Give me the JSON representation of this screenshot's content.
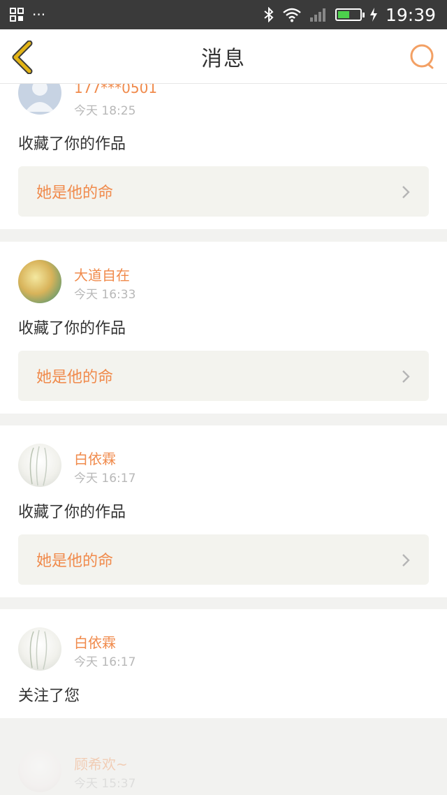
{
  "status_bar": {
    "left_dots": "···",
    "time": "19:39",
    "battery_level": 0.55
  },
  "nav": {
    "title": "消息"
  },
  "colors": {
    "accent": "#f08a4b",
    "back_icon": "#e3b416",
    "search_icon": "#f3a064"
  },
  "messages": [
    {
      "username": "177***0501",
      "time": "今天  18:25",
      "action": "收藏了你的作品",
      "work_title": "她是他的命"
    },
    {
      "username": "大道自在",
      "time": "今天  16:33",
      "action": "收藏了你的作品",
      "work_title": "她是他的命"
    },
    {
      "username": "白依霖",
      "time": "今天  16:17",
      "action": "收藏了你的作品",
      "work_title": "她是他的命"
    },
    {
      "username": "白依霖",
      "time": "今天  16:17",
      "action": "关注了您"
    },
    {
      "username": "顾希欢~",
      "time": "今天  15:37"
    }
  ]
}
